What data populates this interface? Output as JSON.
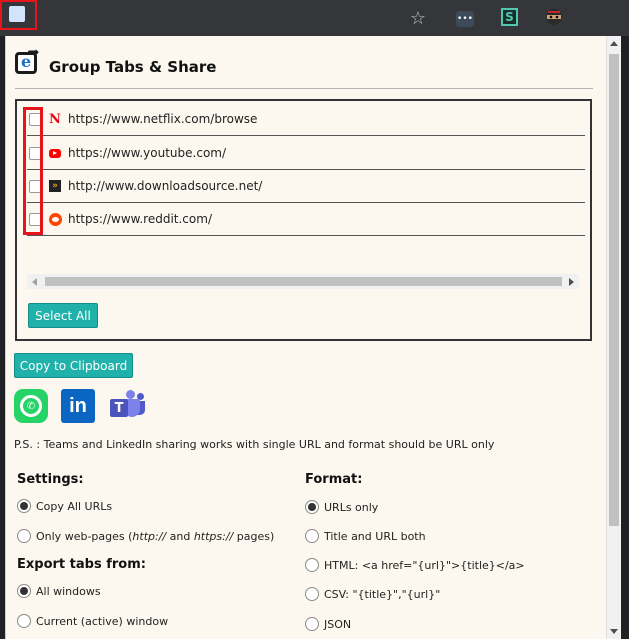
{
  "browser": {
    "icons": [
      "star-icon",
      "dots-extension-icon",
      "s-extension-icon",
      "ninja-extension-icon",
      "group-tabs-share-icon"
    ]
  },
  "popup": {
    "title": "Group Tabs & Share",
    "tabs": [
      {
        "url": "https://www.netflix.com/browse",
        "favicon": "netflix-icon"
      },
      {
        "url": "https://www.youtube.com/",
        "favicon": "youtube-icon"
      },
      {
        "url": "http://www.downloadsource.net/",
        "favicon": "downloadsource-icon"
      },
      {
        "url": "https://www.reddit.com/",
        "favicon": "reddit-icon"
      }
    ],
    "select_all_label": "Select All",
    "copy_label": "Copy to Clipboard",
    "ps_note": "P.S. : Teams and LinkedIn sharing works with single URL and format should be URL only",
    "settings": {
      "heading": "Settings:",
      "copy_all": "Copy All URLs",
      "only_web_prefix": "Only web-pages (",
      "only_web_http": "http://",
      "only_web_and": " and ",
      "only_web_https": "https://",
      "only_web_suffix": " pages)"
    },
    "export": {
      "heading": "Export tabs from:",
      "all_windows": "All windows",
      "current_window": "Current (active) window"
    },
    "format": {
      "heading": "Format:",
      "options": [
        "URLs only",
        "Title and URL both",
        "HTML: <a href=\"{url}\">{title}</a>",
        "CSV: \"{title}\",\"{url}\"",
        "JSON"
      ],
      "selected": "URLs only"
    },
    "colors": {
      "accent": "#20b2aa",
      "highlight": "#e8141c"
    }
  }
}
